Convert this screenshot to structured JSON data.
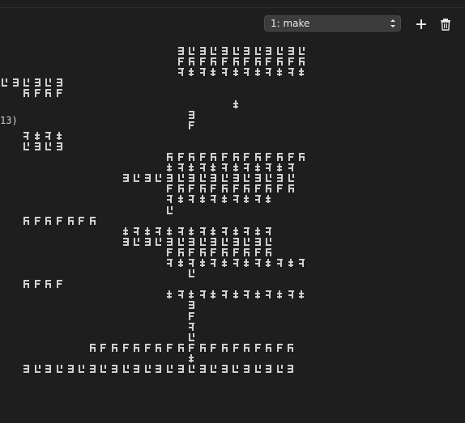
{
  "toolbar": {
    "terminal_select_value": "1: make",
    "new_terminal_icon": "plus-icon",
    "kill_terminal_icon": "trash-icon"
  },
  "terminal": {
    "visible_text": "13)",
    "garbled_rows": [
      {
        "col": 16,
        "count": 12
      },
      {
        "col": 16,
        "count": 12
      },
      {
        "col": 16,
        "count": 12
      },
      {
        "col": 0,
        "count": 6
      },
      {
        "col": 2,
        "count": 4
      },
      {
        "col": 21,
        "count": 1
      },
      {
        "col": 17,
        "count": 1
      },
      {
        "col": 17,
        "count": 1
      },
      {
        "col": 2,
        "count": 4
      },
      {
        "col": 2,
        "count": 4
      },
      {
        "col": 15,
        "count": 13
      },
      {
        "col": 15,
        "count": 12
      },
      {
        "col": 11,
        "count": 16
      },
      {
        "col": 15,
        "count": 12
      },
      {
        "col": 15,
        "count": 10
      },
      {
        "col": 15,
        "count": 1
      },
      {
        "col": 2,
        "count": 7
      },
      {
        "col": 11,
        "count": 14
      },
      {
        "col": 11,
        "count": 14
      },
      {
        "col": 15,
        "count": 10
      },
      {
        "col": 15,
        "count": 13
      },
      {
        "col": 17,
        "count": 1
      },
      {
        "col": 2,
        "count": 4
      },
      {
        "col": 15,
        "count": 13
      },
      {
        "col": 17,
        "count": 1
      },
      {
        "col": 17,
        "count": 1
      },
      {
        "col": 17,
        "count": 1
      },
      {
        "col": 17,
        "count": 1
      },
      {
        "col": 8,
        "count": 19
      },
      {
        "col": 17,
        "count": 1
      },
      {
        "col": 2,
        "count": 25
      }
    ]
  }
}
